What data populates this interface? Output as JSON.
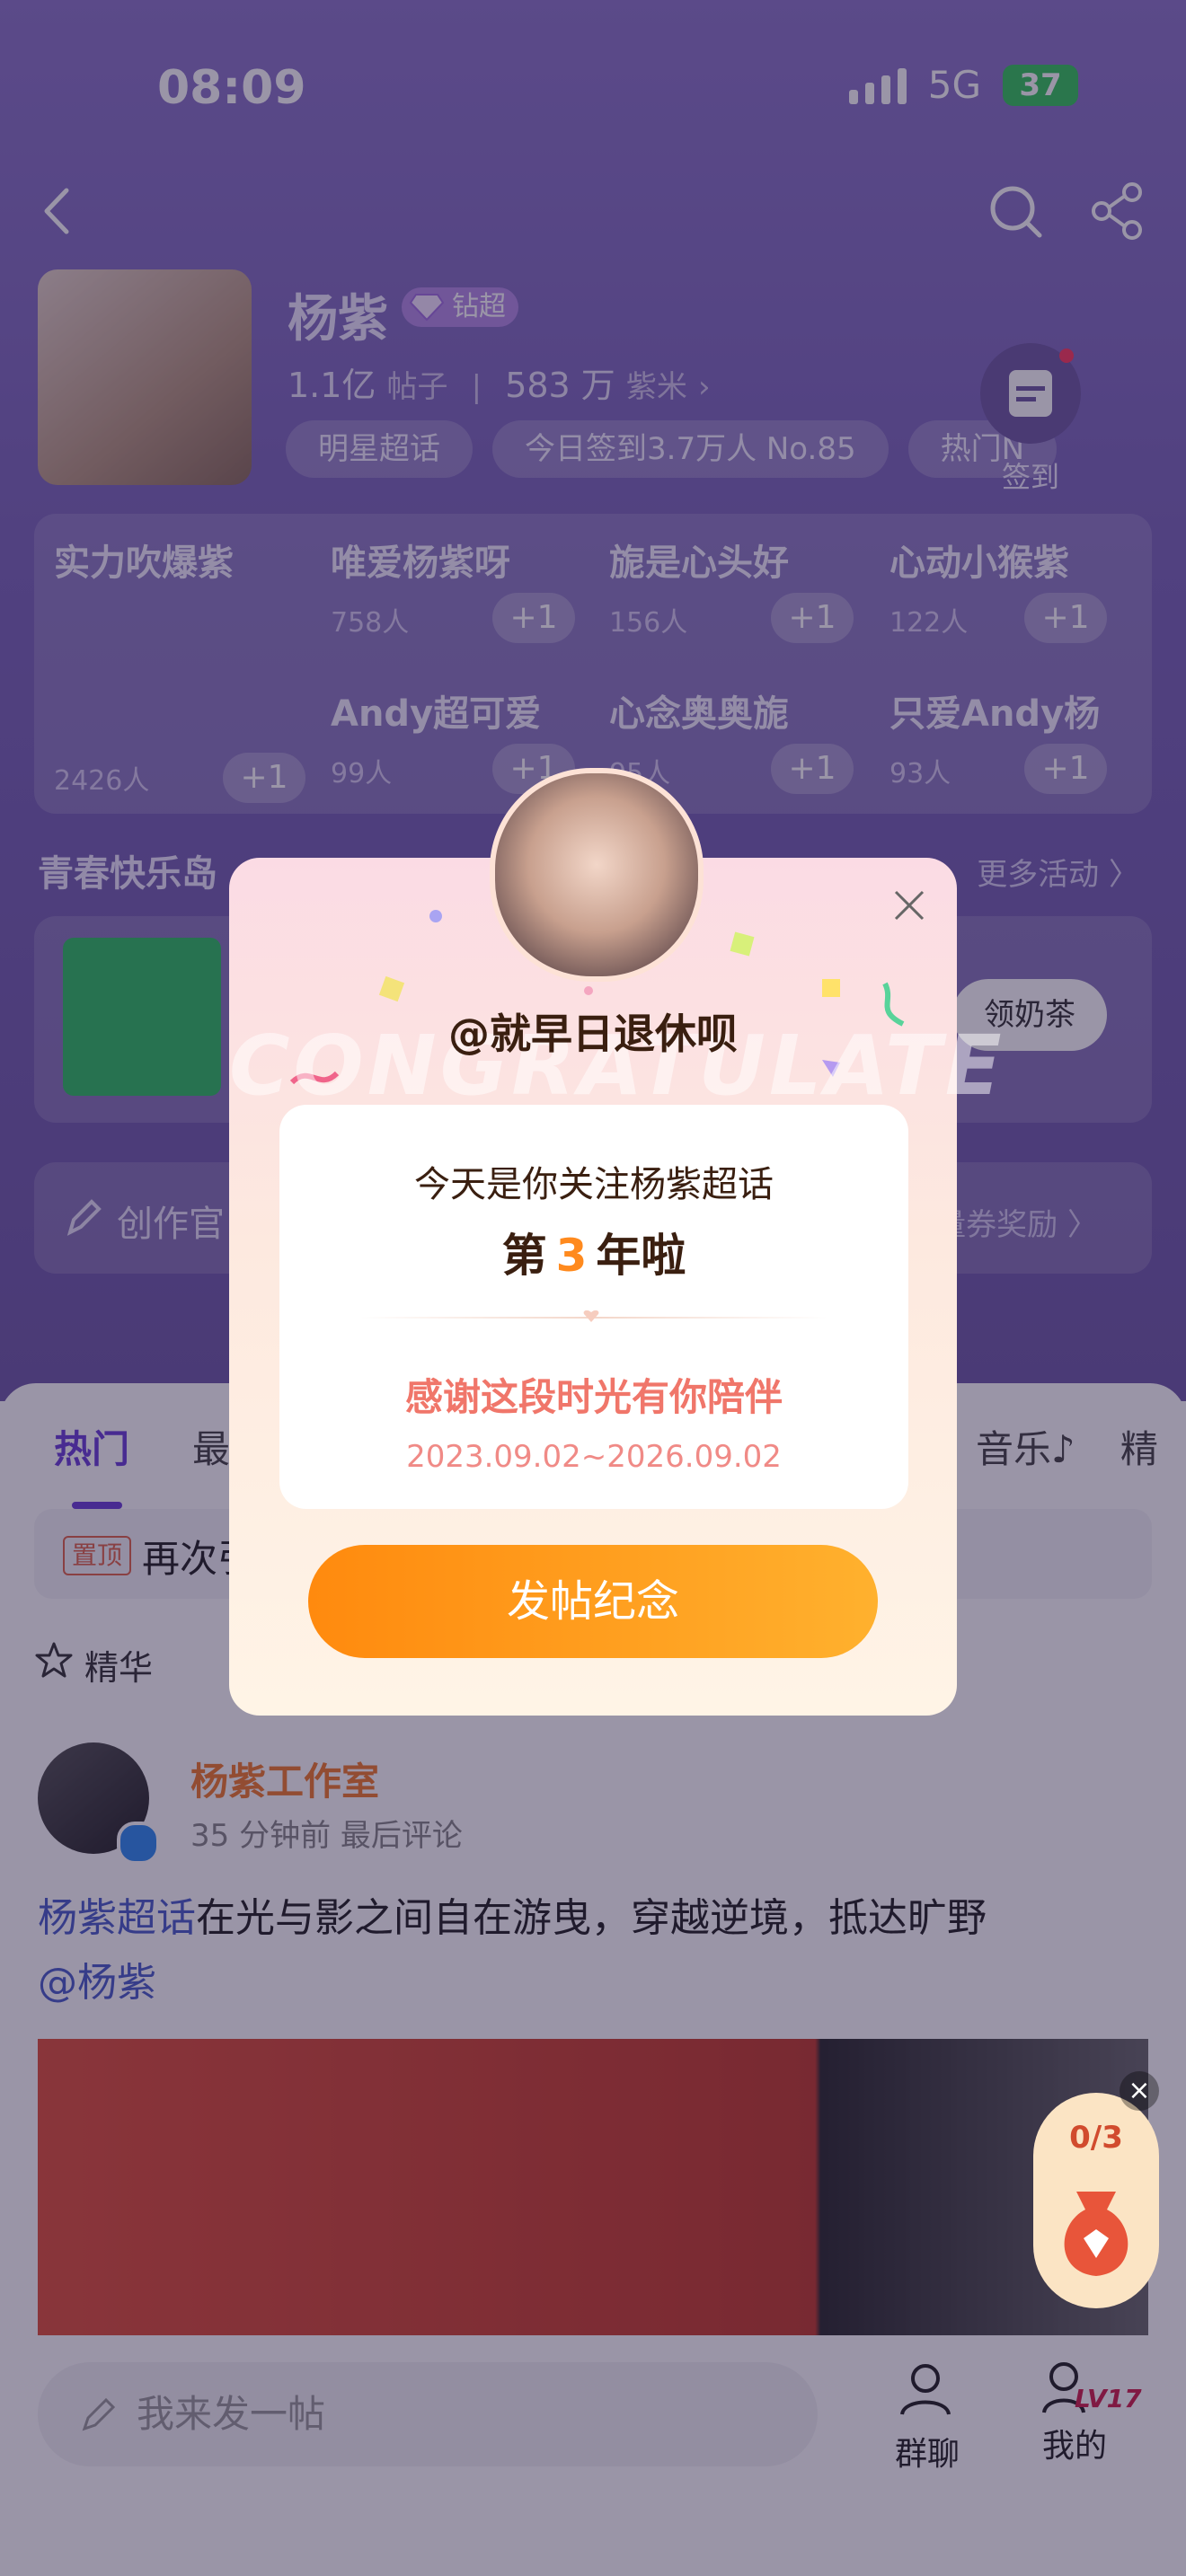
{
  "status": {
    "time": "08:09",
    "network": "5G",
    "battery": "37"
  },
  "profile": {
    "name": "杨紫",
    "badge": "钻超",
    "posts_count": "1.1亿",
    "posts_label": "帖子",
    "fans_count": "583 万",
    "fans_label": "紫米",
    "chips": [
      "明星超话",
      "今日签到3.7万人 No.85",
      "热门N"
    ],
    "checkin_label": "签到"
  },
  "groups": [
    {
      "name": "实力吹爆紫",
      "count": "2426人",
      "plus": "+1"
    },
    {
      "name": "唯爱杨紫呀",
      "count": "758人",
      "plus": "+1"
    },
    {
      "name": "旎是心头好",
      "count": "156人",
      "plus": "+1"
    },
    {
      "name": "心动小猴紫",
      "count": "122人",
      "plus": "+1"
    },
    {
      "name": "Andy超可爱",
      "count": "99人",
      "plus": "+1"
    },
    {
      "name": "心念奥奥旎",
      "count": "95人",
      "plus": "+1"
    },
    {
      "name": "只爱Andy杨",
      "count": "93人",
      "plus": "+1"
    }
  ],
  "activity": {
    "section_title": "青春快乐岛",
    "more": "更多活动 〉",
    "button": "领奶茶"
  },
  "creator": {
    "label": "创作官",
    "right": "流量券奖励 〉"
  },
  "tabs": [
    "热门",
    "最",
    "音乐♪",
    "精"
  ],
  "pinned": {
    "tag": "置顶",
    "text": "再次引"
  },
  "essence": {
    "label": "精华"
  },
  "post": {
    "author": "杨紫工作室",
    "author_badge": "大咖",
    "meta": "35 分钟前 最后评论",
    "topic": "杨紫超话",
    "text": "在光与影之间自在游曳，穿越逆境，抵达旷野",
    "mention": "@杨紫"
  },
  "reward": {
    "progress": "0/3",
    "close": "×"
  },
  "bottom": {
    "compose_placeholder": "我来发一帖",
    "group_chat": "群聊",
    "mine": "我的",
    "level": "LV17"
  },
  "modal": {
    "handle": "@就早日退休呗",
    "watermark": "CONGRATULATE",
    "line1": "今天是你关注杨紫超话",
    "line2_prefix": "第",
    "years": "3",
    "line2_suffix": "年啦",
    "thanks": "感谢这段时光有你陪伴",
    "date_range": "2023.09.02~2026.09.02",
    "post_button": "发帖纪念"
  }
}
